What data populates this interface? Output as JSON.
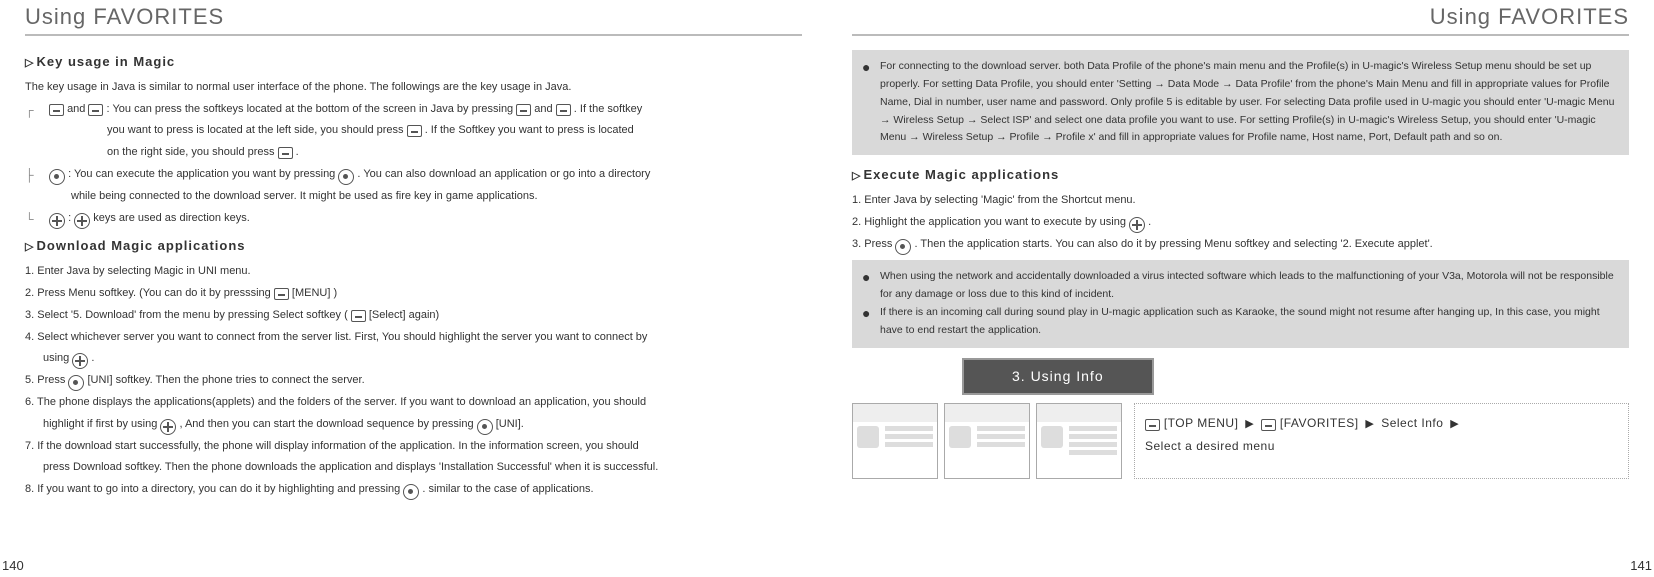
{
  "pageTitleLeft": "Using FAVORITES",
  "pageTitleRight": "Using FAVORITES",
  "pageNumLeft": "140",
  "pageNumRight": "141",
  "left": {
    "sec1_title": "Key usage in Magic",
    "intro": "The key usage in Java is similar to normal user interface of the phone. The followings are the key usage in Java.",
    "k1a": " and ",
    "k1b": " : You can press the softkeys located at the bottom of the screen in Java by pressing ",
    "k1c": " and ",
    "k1d": " . If the softkey",
    "k1_line2": "you want to press is located at the left side, you should press ",
    "k1_line2b": " . If the Softkey you want to press is located",
    "k1_line3": "on the right side, you should press ",
    "k1_line3b": " .",
    "k2a": " : You can execute the application you want by pressing ",
    "k2b": " . You can also download an application or go into a directory",
    "k2_line2": "while being connected to the download server. It might be used as fire key in game applications.",
    "k3a": " : ",
    "k3b": " keys are used as direction keys.",
    "sec2_title": "Download Magic applications",
    "d1": "1. Enter Java by selecting Magic in UNI menu.",
    "d2a": "2. Press Menu softkey. (You can do it by presssing ",
    "d2b": " [MENU] )",
    "d3a": "3. Select '5. Download' from the menu by pressing Select softkey ( ",
    "d3b": " [Select] again)",
    "d4a": "4. Select whichever server you want to connect from the server list. First, You should highlight the server you want to connect by",
    "d4b_pre": "using ",
    "d4b_post": " .",
    "d5a": "5. Press ",
    "d5b": " [UNI] softkey. Then the phone tries to connect the server.",
    "d6a": "6. The phone displays the applications(applets) and the folders of the server. If you want to download an application, you should",
    "d6b_pre": "highlight if first by using ",
    "d6b_mid": " , And then you can start the download sequence by pressing ",
    "d6b_post": " [UNI].",
    "d7a": "7. If the download start successfully, the phone will display information of the application. In the information screen, you should",
    "d7b": "press Download softkey. Then the phone downloads the application and displays 'Installation Successful' when it is successful.",
    "d8a": "8. If you want to go into a directory, you can do it by highlighting and pressing ",
    "d8b": " . similar to the case of applications."
  },
  "right": {
    "note1": "For connecting to the download server. both Data Profile of the phone's main menu and the Profile(s) in U-magic's Wireless Setup menu should be set up properly. For setting Data Profile, you should enter 'Setting → Data Mode → Data Profile' from the phone's Main Menu and fill in appropriate values for Profile Name, Dial in number, user name and password. Only profile 5 is editable by user. For selecting Data profile used in U-magic you should enter 'U-magic Menu → Wireless Setup → Select ISP' and select one data profile you want to use. For setting Profile(s) in U-magic's Wireless Setup, you should enter 'U-magic Menu → Wireless Setup → Profile → Profile x' and fill in appropriate values for Profile name, Host name, Port, Default path and so on.",
    "sec3_title": "Execute Magic applications",
    "e1": "1. Enter Java by selecting 'Magic' from the Shortcut menu.",
    "e2a": "2. Highlight the application you want to execute by using ",
    "e2b": " .",
    "e3a": "3. Press ",
    "e3b": " . Then the application starts. You can also do it by pressing Menu softkey and selecting '2. Execute applet'.",
    "note2a": "When using the network and accidentally downloaded a virus intected software which leads to the malfunctioning of your V3a, Motorola will not be responsible for any damage or loss due to this kind of incident.",
    "note2b": "If there is an incoming call during sound play in U-magic application such as Karaoke, the sound might not resume after hanging up, In this case, you might have to end restart the application.",
    "chapter": "3. Using Info",
    "navA": " [TOP MENU] ",
    "navB": " [FAVORITES] ",
    "navC": " Select Info ",
    "nav2": "Select a desired menu"
  }
}
